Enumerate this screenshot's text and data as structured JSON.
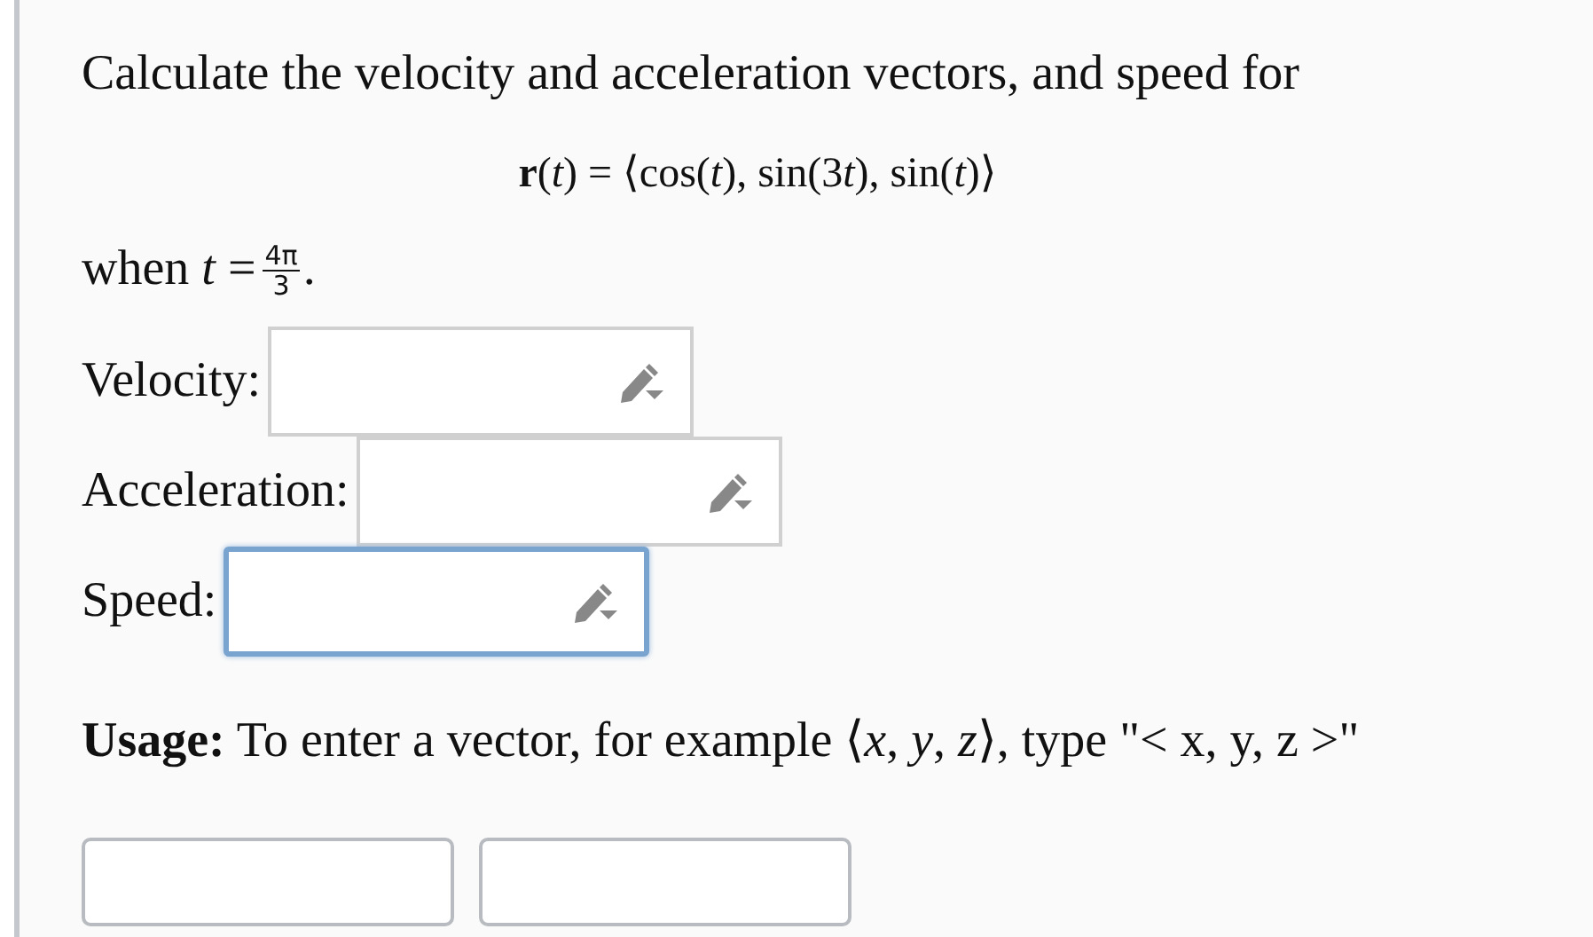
{
  "question": {
    "intro": "Calculate the velocity and acceleration vectors, and speed for",
    "formula": [
      "**r**(*t*) = ⟨cos(*t*), sin(3",
      "*t*), sin(*t*)⟩"
    ],
    "condition": {
      "prefix": "when *t* = ",
      "numerator": "4π",
      "denominator": "3",
      "suffix": "."
    }
  },
  "fields": [
    {
      "label": "Velocity:",
      "focused": false
    },
    {
      "label": "Acceleration:",
      "focused": false
    },
    {
      "label": "Speed:",
      "focused": true
    }
  ],
  "usage": "**Usage:** To enter a vector, for example ⟨*x*, *y*, *z*⟩, type \"< x, y, z >\"",
  "buttons": [
    {
      "kind": "plain"
    },
    {
      "kind": "plain"
    }
  ]
}
